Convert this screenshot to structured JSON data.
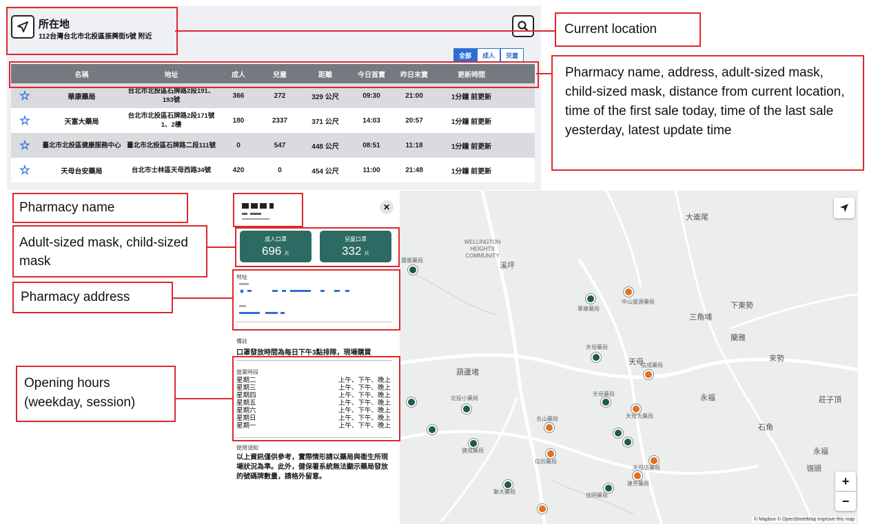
{
  "header": {
    "title": "所在地",
    "address": "112台灣台北市北投區振興街5號 附近"
  },
  "filters": [
    {
      "label": "全部",
      "active": true
    },
    {
      "label": "成人",
      "active": false
    },
    {
      "label": "兒童",
      "active": false
    }
  ],
  "table": {
    "columns": [
      "名稱",
      "地址",
      "成人",
      "兒童",
      "距離",
      "今日首賣",
      "昨日末賣",
      "更新時間"
    ],
    "rows": [
      {
        "name": "華康藥局",
        "address": "台北市北投區石牌路2段191、193號",
        "adult": "366",
        "child": "272",
        "distance": "329 公尺",
        "first_sale": "09:30",
        "last_sale": "21:00",
        "updated": "1分鐘 前更新"
      },
      {
        "name": "天富大藥局",
        "address": "台北市北投區石牌路2段171號1、2樓",
        "adult": "180",
        "child": "2337",
        "distance": "371 公尺",
        "first_sale": "14:03",
        "last_sale": "20:57",
        "updated": "1分鐘 前更新"
      },
      {
        "name": "臺北市北投區健康服務中心",
        "address": "臺北市北投區石牌路二段111號",
        "adult": "0",
        "child": "547",
        "distance": "448 公尺",
        "first_sale": "08:51",
        "last_sale": "11:18",
        "updated": "1分鐘 前更新"
      },
      {
        "name": "天母台安藥局",
        "address": "台北市士林區天母西路34號",
        "adult": "420",
        "child": "0",
        "distance": "454 公尺",
        "first_sale": "11:00",
        "last_sale": "21:48",
        "updated": "1分鐘 前更新"
      }
    ]
  },
  "callouts": {
    "current_location": "Current location",
    "table_columns": "Pharmacy name, address, adult-sized mask, child-sized mask, distance from current location, time of the first sale today, time of the last sale yesterday, latest update time",
    "pharmacy_name": "Pharmacy name",
    "mask_counts": "Adult-sized mask, child-sized mask",
    "pharmacy_address": "Pharmacy address",
    "opening_hours": "Opening hours (weekday, session)"
  },
  "side_panel": {
    "adult_label": "成人口罩",
    "adult_value": "696",
    "child_label": "兒童口罩",
    "child_value": "332",
    "unit": "片",
    "address_heading": "地址",
    "note_heading": "備註",
    "note_text": "口罩發放時間為每日下午3點排隊，現場購買",
    "hours_heading": "營業時段",
    "hours": [
      {
        "day": "星期二",
        "session": "上午、下午、晚上"
      },
      {
        "day": "星期三",
        "session": "上午、下午、晚上"
      },
      {
        "day": "星期四",
        "session": "上午、下午、晚上"
      },
      {
        "day": "星期五",
        "session": "上午、下午、晚上"
      },
      {
        "day": "星期六",
        "session": "上午、下午、晚上"
      },
      {
        "day": "星期日",
        "session": "上午、下午、晚上"
      },
      {
        "day": "星期一",
        "session": "上午、下午、晚上"
      }
    ],
    "disclaimer_heading": "使用須知",
    "disclaimer_text": "以上資訊僅供參考，實際情形請以藥局與衛生所現場狀況為準。此外，健保署系統無法顯示藥局發放的號碼牌數量，請格外留意。"
  },
  "map": {
    "labels": [
      "WELLINGTON HEIGHTS COMMUNITY",
      "天母",
      "三角埔",
      "永福",
      "石角",
      "永福",
      "下東勢",
      "來勢",
      "莊子頂",
      "蘭雅",
      "大崙尾",
      "溪坪",
      "嶺頭",
      "葫蘆堵"
    ],
    "pharmacy_labels": [
      "華康藥局",
      "中山盛源藥局",
      "天母藥局",
      "天母藥局",
      "信成藥局",
      "天母大藥局",
      "天母店藥局",
      "名山藥局",
      "健成藥局",
      "信欣藥局",
      "北投小藥局",
      "蕭雅藥局",
      "聯大藥局",
      "建芳藥局",
      "佳明藥局"
    ],
    "attribution": "© Mapbox © OpenStreetMap Improve this map"
  }
}
